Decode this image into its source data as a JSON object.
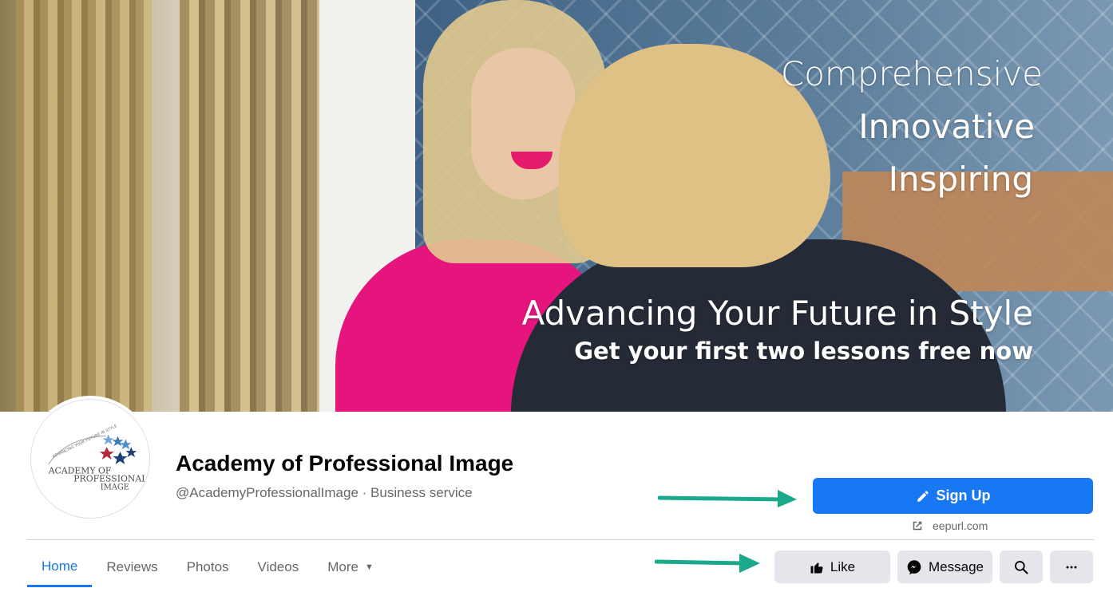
{
  "cover": {
    "line1": "Comprehensive",
    "line2": "Innovative",
    "line3": "Inspiring",
    "tagline": "Advancing Your Future in Style",
    "cta": "Get your first two lessons free now"
  },
  "profile": {
    "logo_text_1": "ACADEMY OF",
    "logo_text_2": "PROFESSIONAL",
    "logo_text_3": "IMAGE",
    "logo_arc_text": "ADVANCING YOUR FUTURE IN STYLE",
    "name": "Academy of Professional Image",
    "subtitle": "@AcademyProfessionalImage · Business service"
  },
  "actions": {
    "signup_label": "Sign Up",
    "website_label": "eepurl.com",
    "like_label": "Like",
    "message_label": "Message"
  },
  "tabs": [
    {
      "label": "Home"
    },
    {
      "label": "Reviews"
    },
    {
      "label": "Photos"
    },
    {
      "label": "Videos"
    },
    {
      "label": "More"
    }
  ],
  "colors": {
    "primary": "#1877f2",
    "secondary_button": "#e4e6eb",
    "annotation_arrow": "#1aa98a"
  },
  "icons": [
    "pencil-icon",
    "external-link-icon",
    "thumbs-up-icon",
    "messenger-icon",
    "search-icon",
    "more-icon",
    "caret-down-icon",
    "annotation-arrow"
  ]
}
